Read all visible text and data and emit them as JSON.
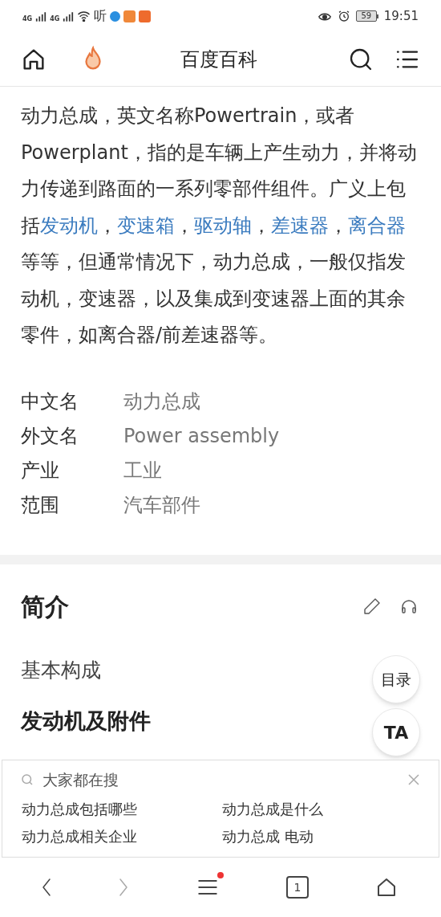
{
  "status_bar": {
    "network_1": "4G",
    "network_2": "4G",
    "listen": "听",
    "battery": "59",
    "time": "19:51"
  },
  "header": {
    "title": "百度百科"
  },
  "summary": [
    {
      "text": "动力总成，英文名称Powertrain，或者Powerplant，指的是车辆上产生动力，并将动力传递到路面的一系列零部件组件。广义上包括",
      "link": false
    },
    {
      "text": "发动机",
      "link": true
    },
    {
      "text": "，",
      "link": false
    },
    {
      "text": "变速箱",
      "link": true
    },
    {
      "text": "，",
      "link": false
    },
    {
      "text": "驱动轴",
      "link": true
    },
    {
      "text": "，",
      "link": false
    },
    {
      "text": "差速器",
      "link": true
    },
    {
      "text": "，",
      "link": false
    },
    {
      "text": "离合器",
      "link": true
    },
    {
      "text": "等等，但通常情况下，动力总成，一般仅指发动机，变速器，以及集成到变速器上面的其余零件，如离合器/前差速器等。",
      "link": false
    }
  ],
  "infobox": [
    {
      "label": "中文名",
      "value": "动力总成"
    },
    {
      "label": "外文名",
      "value": "Power assembly"
    },
    {
      "label": "产业",
      "value": "工业"
    },
    {
      "label": "范围",
      "value": "汽车部件"
    }
  ],
  "section": {
    "title": "简介",
    "items": [
      {
        "text": "基本构成",
        "kind": "subheading"
      },
      {
        "text": "发动机及附件",
        "kind": "heading"
      }
    ]
  },
  "float_buttons": [
    "目录",
    "TA"
  ],
  "search_panel": {
    "title": "大家都在搜",
    "suggestions": [
      "动力总成包括哪些",
      "动力总成是什么",
      "动力总成相关企业",
      "动力总成 电动"
    ]
  },
  "bottom_nav": {
    "tabs_count": "1",
    "menu_badge": true
  }
}
